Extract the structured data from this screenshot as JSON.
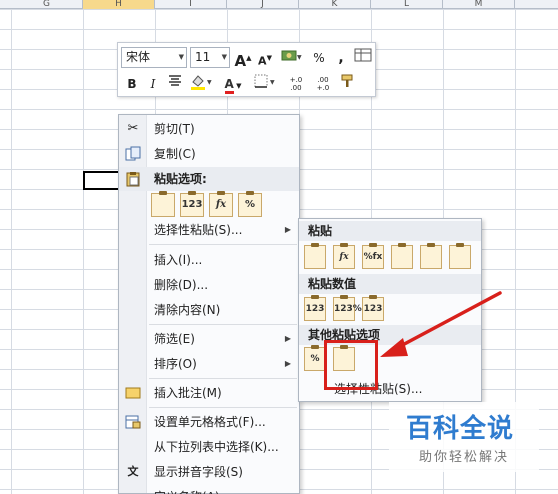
{
  "columns": [
    "G",
    "H",
    "I",
    "J",
    "K",
    "L",
    "M"
  ],
  "selected_column": "H",
  "mini_toolbar": {
    "font_name": "宋体",
    "font_size": "11",
    "bold": "B",
    "italic": "I",
    "percent": "%",
    "comma": ",",
    "font_color_letter": "A",
    "grow_font": "A",
    "shrink_font": "A",
    "decimal_increase": "+.0\n.00",
    "decimal_decrease": ".00\n+.0"
  },
  "context_menu": {
    "cut": "剪切(T)",
    "copy": "复制(C)",
    "paste_options_header": "粘贴选项:",
    "paste_options": [
      "",
      "123",
      "fx",
      "%"
    ],
    "paste_special": "选择性粘贴(S)...",
    "insert": "插入(I)...",
    "delete": "删除(D)...",
    "clear_contents": "清除内容(N)",
    "filter": "筛选(E)",
    "sort": "排序(O)",
    "insert_comment": "插入批注(M)",
    "format_cells": "设置单元格格式(F)...",
    "pick_from_list": "从下拉列表中选择(K)...",
    "show_phonetic": "显示拼音字段(S)",
    "define_name": "定义名称(A)..."
  },
  "submenu": {
    "paste_header": "粘贴",
    "paste_icons": [
      "",
      "fx",
      "%fx",
      "",
      "",
      ""
    ],
    "paste_values_header": "粘贴数值",
    "paste_values_icons": [
      "123",
      "123%",
      "123"
    ],
    "other_header": "其他粘贴选项",
    "other_icons": [
      "%",
      ""
    ],
    "paste_special": "选择性粘贴(S)..."
  },
  "annotation_color": "#d8201b",
  "watermark": {
    "title": "百科全说",
    "subtitle": "助你轻松解决"
  }
}
